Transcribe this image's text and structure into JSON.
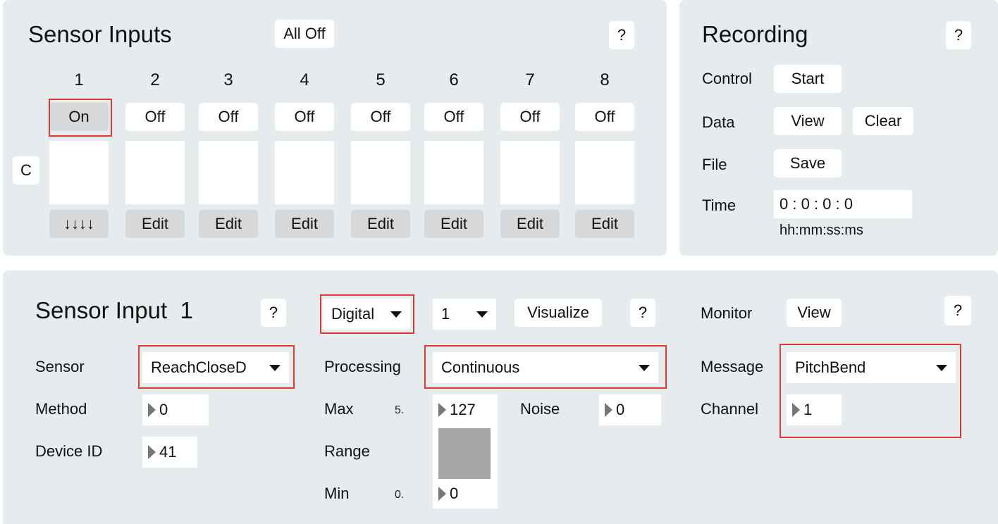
{
  "sensor_inputs": {
    "title": "Sensor Inputs",
    "all_off": "All Off",
    "help": "?",
    "row_label": "C",
    "channels": [
      {
        "num": "1",
        "state": "On",
        "action": "↓↓↓↓"
      },
      {
        "num": "2",
        "state": "Off",
        "action": "Edit"
      },
      {
        "num": "3",
        "state": "Off",
        "action": "Edit"
      },
      {
        "num": "4",
        "state": "Off",
        "action": "Edit"
      },
      {
        "num": "5",
        "state": "Off",
        "action": "Edit"
      },
      {
        "num": "6",
        "state": "Off",
        "action": "Edit"
      },
      {
        "num": "7",
        "state": "Off",
        "action": "Edit"
      },
      {
        "num": "8",
        "state": "Off",
        "action": "Edit"
      }
    ]
  },
  "recording": {
    "title": "Recording",
    "help": "?",
    "control_label": "Control",
    "start": "Start",
    "data_label": "Data",
    "view": "View",
    "clear": "Clear",
    "file_label": "File",
    "save": "Save",
    "time_label": "Time",
    "time_value": "0 : 0 : 0 : 0",
    "time_format": "hh:mm:ss:ms"
  },
  "detail": {
    "title": "Sensor Input",
    "index": "1",
    "help": "?",
    "mode": "Digital",
    "mode_channel": "1",
    "visualize": "Visualize",
    "help2": "?",
    "monitor_label": "Monitor",
    "monitor_view": "View",
    "help3": "?",
    "sensor_label": "Sensor",
    "sensor_value": "ReachCloseD",
    "method_label": "Method",
    "method_value": "0",
    "device_id_label": "Device ID",
    "device_id_value": "41",
    "processing_label": "Processing",
    "processing_value": "Continuous",
    "max_label": "Max",
    "max_hint": "5.",
    "max_value": "127",
    "noise_label": "Noise",
    "noise_value": "0",
    "range_label": "Range",
    "min_label": "Min",
    "min_hint": "0.",
    "min_value": "0",
    "message_label": "Message",
    "message_value": "PitchBend",
    "channel_label": "Channel",
    "channel_value": "1"
  },
  "colors": {
    "panel": "#e6ecee",
    "highlight": "#e03c31",
    "button_gray": "#d6d8d9",
    "range_fill": "#a6a6a6"
  }
}
